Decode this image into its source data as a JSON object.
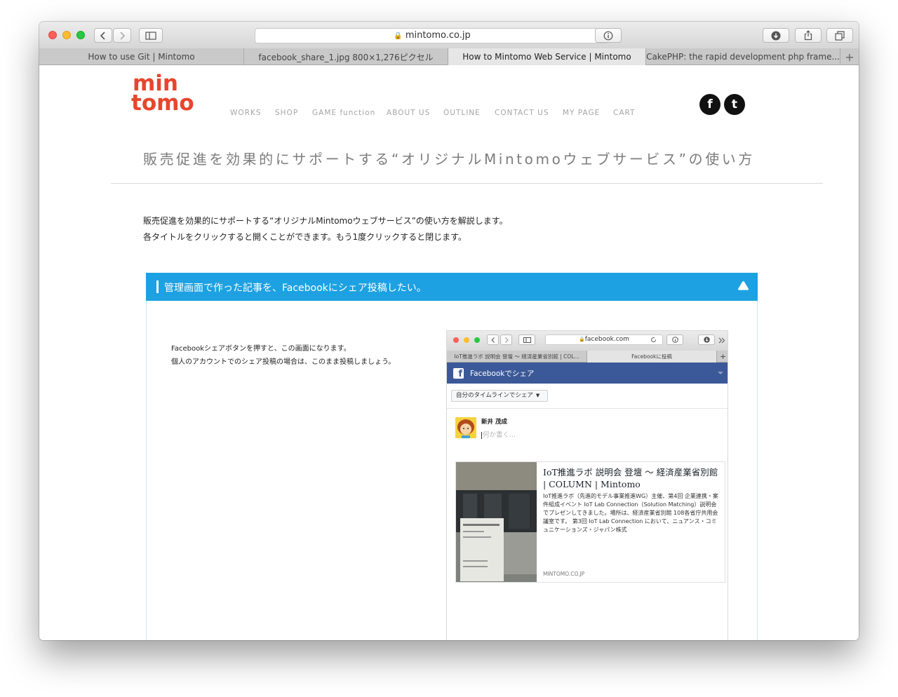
{
  "browser": {
    "url": "mintomo.co.jp",
    "tabs": [
      {
        "label": "How to use Git | Mintomo",
        "active": false
      },
      {
        "label": "facebook_share_1.jpg 800×1,276ピクセル",
        "active": false
      },
      {
        "label": "How to Mintomo Web Service | Mintomo",
        "active": true
      },
      {
        "label": "CakePHP: the rapid development php frame...",
        "active": false
      }
    ],
    "new_tab_icon": "+"
  },
  "site": {
    "logo_top": "min",
    "logo_bottom": "tomo",
    "logo_color": "#e8452c",
    "nav": [
      "WORKS",
      "SHOP",
      "GAME function",
      "ABOUT US",
      "OUTLINE",
      "CONTACT US",
      "MY PAGE",
      "CART"
    ],
    "social": {
      "facebook": "f",
      "twitter": "t"
    }
  },
  "page": {
    "title": "販売促進を効果的にサポートする“オリジナルMintomoウェブサービス”の使い方",
    "intro": [
      "販売促進を効果的にサポートする“オリジナルMintomoウェブサービス”の使い方を解説します。",
      "各タイトルをクリックすると開くことができます。もう1度クリックすると閉じます。"
    ]
  },
  "accordion": {
    "title": "管理画面で作った記事を、Facebookにシェア投稿したい。",
    "color": "#1da1e2",
    "toggle_icon": "triangle-up-icon",
    "description": [
      "Facebookシェアボタンを押すと、この画面になります。",
      "個人のアカウントでのシェア投稿の場合は、このまま投稿しましょう。"
    ]
  },
  "screenshot": {
    "url": "facebook.com",
    "tabs": [
      "IoT推進ラボ 説明会 登壇 〜 経済産業省別館 | COL...",
      "Facebookに投稿"
    ],
    "fb_title": "Facebookでシェア",
    "fb_color": "#3b5998",
    "share_target": "自分のタイムラインでシェア",
    "user_name": "新井 茂成",
    "placeholder": "何か書く...",
    "card": {
      "title": "IoT推進ラボ 説明会 登壇 〜 経済産業省別館 | COLUMN | Mintomo",
      "description": "IoT推進ラボ（先進的モデル事業推進WG）主催、第4回 企業連携・案件組成イベント IoT Lab Connection（Solution Matching）説明会でプレゼンしてきました。場所は、経済産業省別館 108各省庁共用会議室です。 第3回 IoT Lab Connection において、ニュアンス・コミュニケーションズ・ジャパン株式",
      "domain": "MINTOMO.CO.JP"
    }
  }
}
